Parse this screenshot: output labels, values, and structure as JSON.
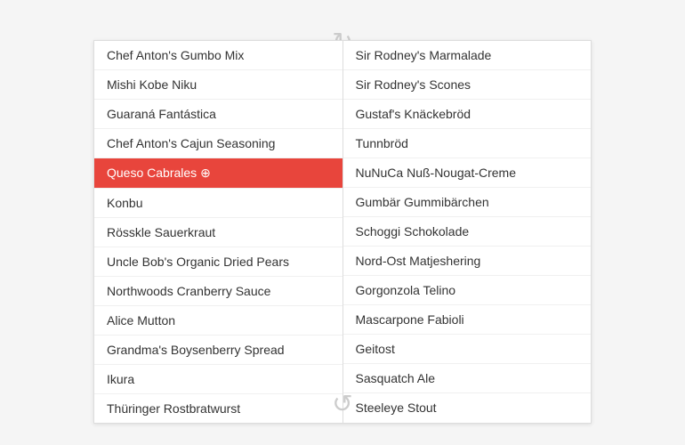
{
  "arrows": {
    "top": "↻",
    "bottom": "↺"
  },
  "left_list": {
    "items": [
      {
        "id": "l1",
        "label": "Chef Anton's Gumbo Mix",
        "selected": false
      },
      {
        "id": "l2",
        "label": "Mishi Kobe Niku",
        "selected": false
      },
      {
        "id": "l3",
        "label": "Guaraná Fantástica",
        "selected": false
      },
      {
        "id": "l4",
        "label": "Chef Anton's Cajun Seasoning",
        "selected": false
      },
      {
        "id": "l5",
        "label": "Queso Cabrales",
        "selected": true
      },
      {
        "id": "l6",
        "label": "Konbu",
        "selected": false
      },
      {
        "id": "l7",
        "label": "Rösskle Sauerkraut",
        "selected": false
      },
      {
        "id": "l8",
        "label": "Uncle Bob's Organic Dried Pears",
        "selected": false
      },
      {
        "id": "l9",
        "label": "Northwoods Cranberry Sauce",
        "selected": false
      },
      {
        "id": "l10",
        "label": "Alice Mutton",
        "selected": false
      },
      {
        "id": "l11",
        "label": "Grandma's Boysenberry Spread",
        "selected": false
      },
      {
        "id": "l12",
        "label": "Ikura",
        "selected": false
      },
      {
        "id": "l13",
        "label": "Thüringer Rostbratwurst",
        "selected": false
      }
    ]
  },
  "right_list": {
    "items": [
      {
        "id": "r1",
        "label": "Sir Rodney's Marmalade"
      },
      {
        "id": "r2",
        "label": "Sir Rodney's Scones"
      },
      {
        "id": "r3",
        "label": "Gustaf's Knäckebröd"
      },
      {
        "id": "r4",
        "label": "Tunnbröd"
      },
      {
        "id": "r5",
        "label": "NuNuCa Nuß-Nougat-Creme"
      },
      {
        "id": "r6",
        "label": "Gumbär Gummibärchen"
      },
      {
        "id": "r7",
        "label": "Schoggi Schokolade"
      },
      {
        "id": "r8",
        "label": "Nord-Ost Matjeshering"
      },
      {
        "id": "r9",
        "label": "Gorgonzola Telino"
      },
      {
        "id": "r10",
        "label": "Mascarpone Fabioli"
      },
      {
        "id": "r11",
        "label": "Geitost"
      },
      {
        "id": "r12",
        "label": "Sasquatch Ale"
      },
      {
        "id": "r13",
        "label": "Steeleye Stout"
      }
    ]
  }
}
